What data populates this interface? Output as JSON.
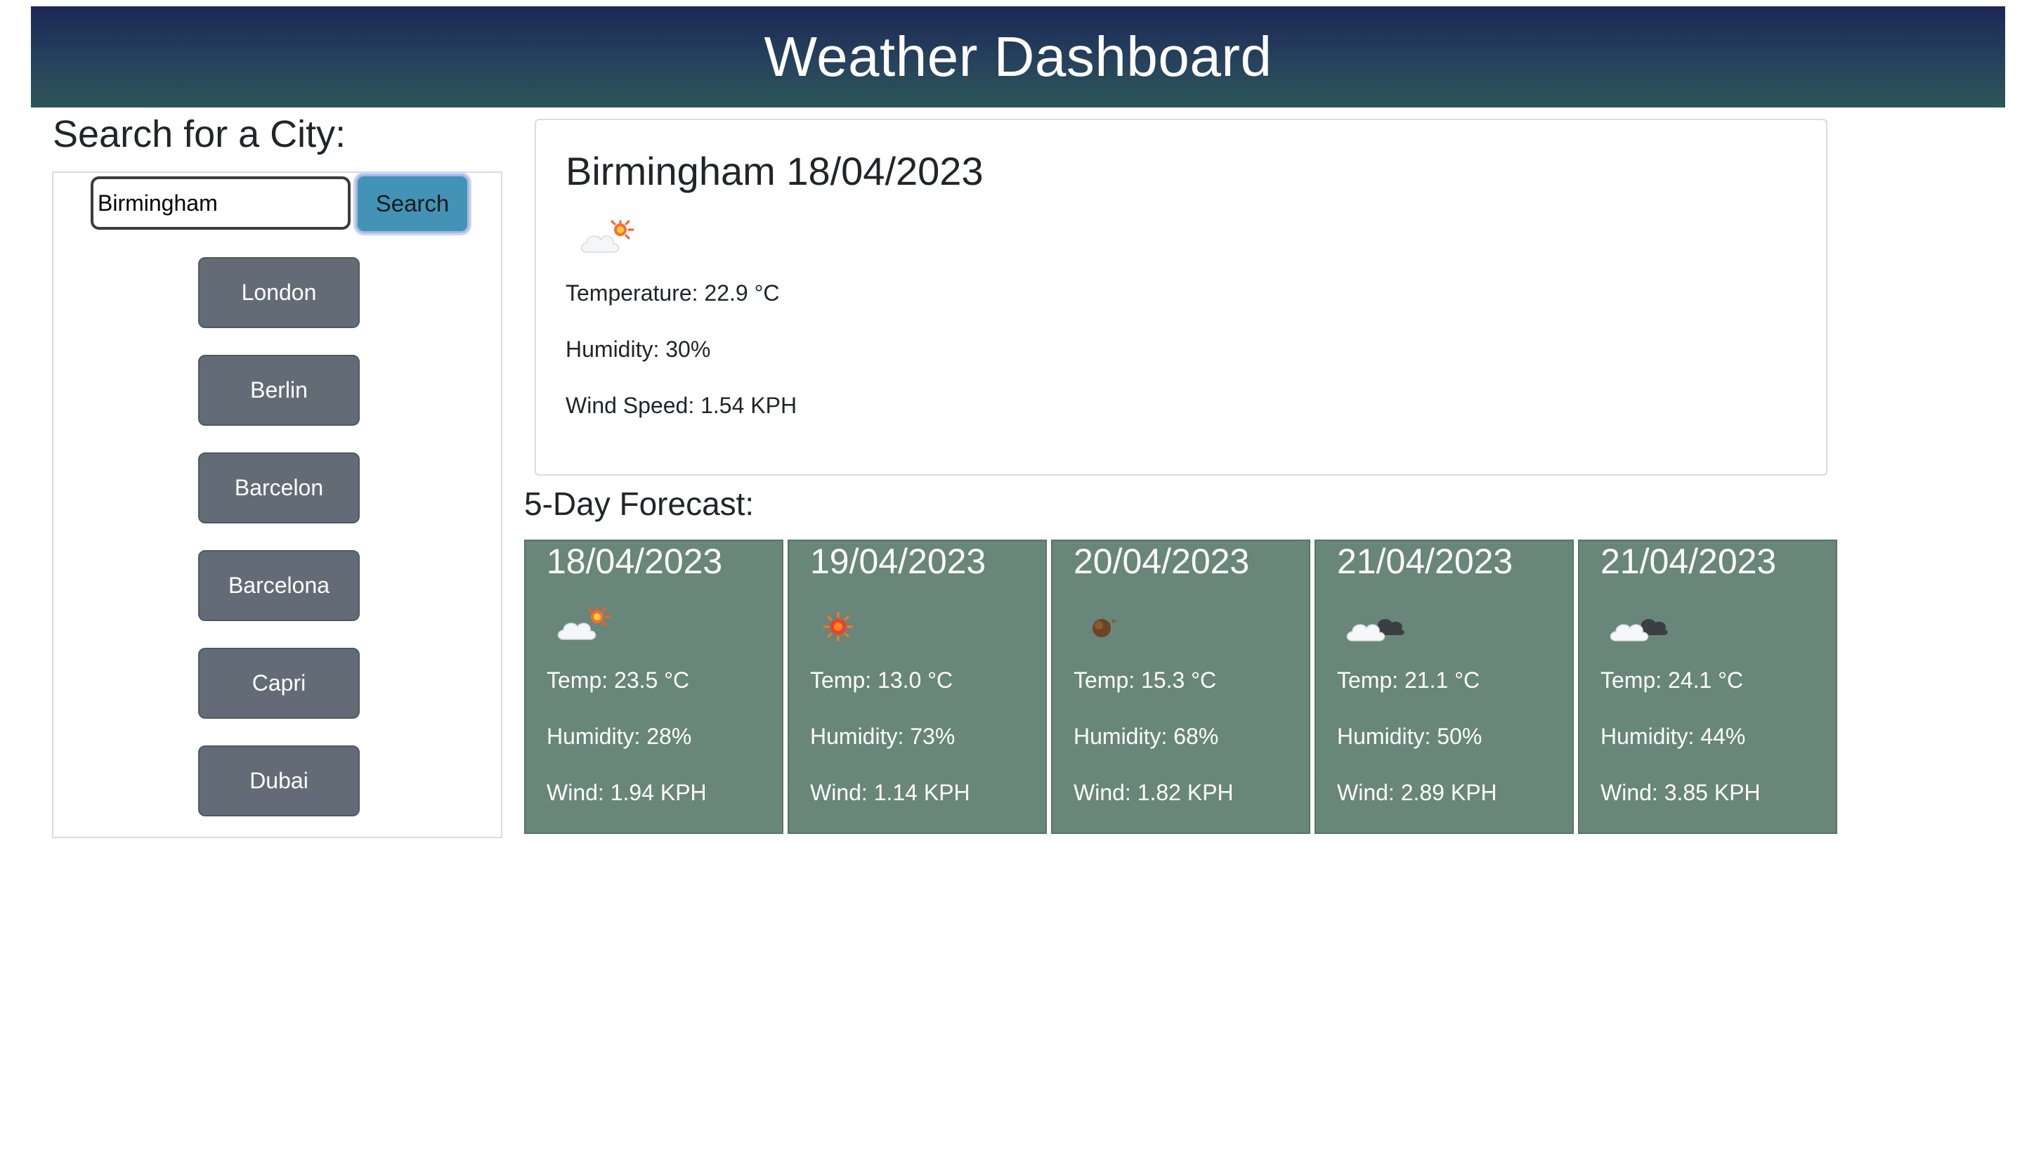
{
  "header": {
    "title": "Weather Dashboard"
  },
  "search": {
    "title": "Search for a City:",
    "input_value": "Birmingham",
    "button_label": "Search",
    "history": [
      "London",
      "Berlin",
      "Barcelon",
      "Barcelona",
      "Capri",
      "Dubai"
    ]
  },
  "current": {
    "title": "Birmingham 18/04/2023",
    "icon": "few-clouds-day-icon",
    "temperature": "Temperature: 22.9 °C",
    "humidity": "Humidity: 30%",
    "wind": "Wind Speed: 1.54 KPH"
  },
  "forecast": {
    "title": "5-Day Forecast:",
    "days": [
      {
        "date": "18/04/2023",
        "icon": "few-clouds-day-icon",
        "temp": "Temp: 23.5 °C",
        "humidity": "Humidity: 28%",
        "wind": "Wind: 1.94 KPH"
      },
      {
        "date": "19/04/2023",
        "icon": "clear-sky-day-icon",
        "temp": "Temp: 13.0 °C",
        "humidity": "Humidity: 73%",
        "wind": "Wind: 1.14 KPH"
      },
      {
        "date": "20/04/2023",
        "icon": "clear-sky-night-icon",
        "temp": "Temp: 15.3 °C",
        "humidity": "Humidity: 68%",
        "wind": "Wind: 1.82 KPH"
      },
      {
        "date": "21/04/2023",
        "icon": "broken-clouds-icon",
        "temp": "Temp: 21.1 °C",
        "humidity": "Humidity: 50%",
        "wind": "Wind: 2.89 KPH"
      },
      {
        "date": "21/04/2023",
        "icon": "broken-clouds-icon",
        "temp": "Temp: 24.1 °C",
        "humidity": "Humidity: 44%",
        "wind": "Wind: 3.85 KPH"
      }
    ]
  },
  "colors": {
    "header_top": "#1c2857",
    "header_bottom": "#2d5658",
    "search_button": "#4393b6",
    "city_button": "#636c76",
    "forecast_card": "#688679"
  }
}
